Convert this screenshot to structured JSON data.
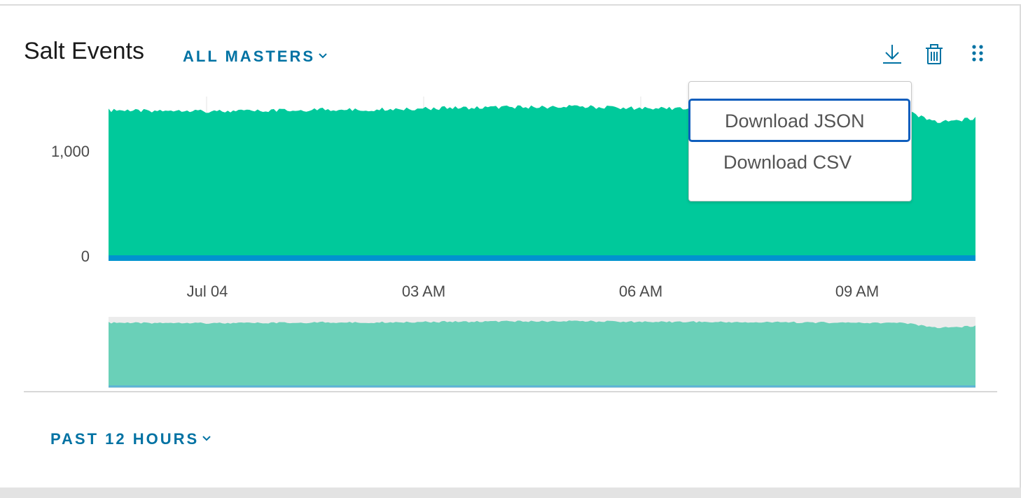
{
  "widget": {
    "title": "Salt Events",
    "master_filter": "ALL MASTERS",
    "time_range": "PAST 12 HOURS",
    "colors": {
      "area_fill": "#00c99b",
      "baseline": "#0093cf",
      "navigator_fill": "#6ad0b8",
      "navigator_bg": "#ececec",
      "accent": "#0072a3",
      "focus_ring": "#0f5ebd"
    }
  },
  "toolbar": {
    "download_icon": "download-icon",
    "delete_icon": "trash-icon",
    "more_icon": "more-dots-icon"
  },
  "download_menu": {
    "items": [
      {
        "label": "Download JSON",
        "focused": true
      },
      {
        "label": "Download CSV",
        "focused": false
      }
    ]
  },
  "chart_data": {
    "type": "area",
    "title": "Salt Events",
    "xlabel": "",
    "ylabel": "",
    "x_ticks": [
      "Jul 04",
      "03 AM",
      "06 AM",
      "09 AM"
    ],
    "y_ticks": [
      "1,000",
      "0"
    ],
    "ylim": [
      0,
      1500
    ],
    "grid": true,
    "series": [
      {
        "x": [
          "00:00",
          "00:30",
          "01:00",
          "01:30",
          "02:00",
          "02:30",
          "03:00",
          "03:30",
          "04:00",
          "04:30",
          "05:00",
          "05:30",
          "06:00",
          "06:30",
          "07:00",
          "07:30",
          "08:00",
          "08:30",
          "09:00",
          "09:30",
          "10:00",
          "10:30",
          "11:00",
          "11:30",
          "12:00"
        ],
        "values": [
          1390,
          1385,
          1395,
          1380,
          1385,
          1390,
          1400,
          1395,
          1405,
          1410,
          1415,
          1420,
          1420,
          1425,
          1415,
          1410,
          1410,
          1405,
          1400,
          1400,
          1395,
          1390,
          1385,
          1280,
          1320
        ]
      },
      {
        "x": [
          "00:00",
          "12:00"
        ],
        "values": [
          5,
          5
        ]
      }
    ]
  }
}
